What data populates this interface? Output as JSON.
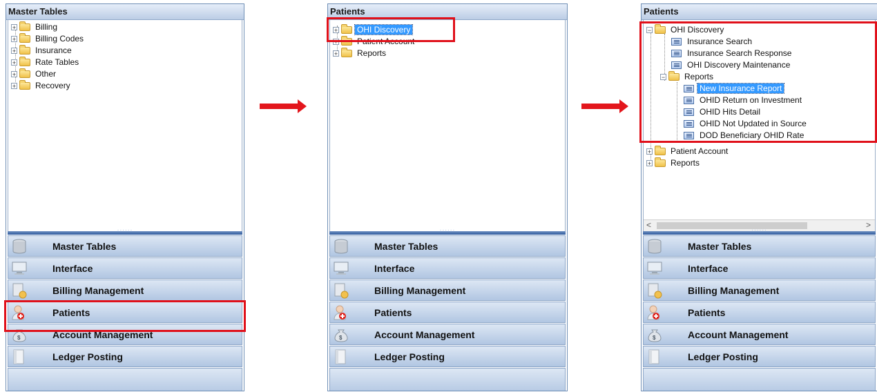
{
  "panel1": {
    "title": "Master Tables",
    "tree": [
      "Billing",
      "Billing Codes",
      "Insurance",
      "Rate Tables",
      "Other",
      "Recovery"
    ]
  },
  "panel2": {
    "title": "Patients",
    "tree": [
      "OHI Discovery",
      "Patient Account",
      "Reports"
    ],
    "selected": "OHI Discovery"
  },
  "panel3": {
    "title": "Patients",
    "tree": {
      "root": "OHI Discovery",
      "children": [
        "Insurance Search",
        "Insurance Search Response",
        "OHI Discovery Maintenance"
      ],
      "reports_folder": "Reports",
      "reports": [
        "New Insurance Report",
        "OHID Return on Investment",
        "OHID Hits Detail",
        "OHID Not Updated in Source",
        "DOD Beneficiary OHID Rate"
      ],
      "siblings": [
        "Patient Account",
        "Reports"
      ]
    },
    "selected": "New Insurance Report",
    "scroll_left": "<",
    "scroll_right": ">"
  },
  "nav": {
    "buttons": [
      "Master Tables",
      "Interface",
      "Billing Management",
      "Patients",
      "Account Management",
      "Ledger Posting"
    ]
  },
  "colors": {
    "highlight": "#e0101a",
    "selection": "#3399ff",
    "arrow": "#e3161c"
  },
  "icons": [
    "expand-icon",
    "folder-icon",
    "document-icon",
    "database-icon",
    "monitor-icon",
    "billing-icon",
    "patient-icon",
    "money-bag-icon",
    "ledger-icon"
  ]
}
